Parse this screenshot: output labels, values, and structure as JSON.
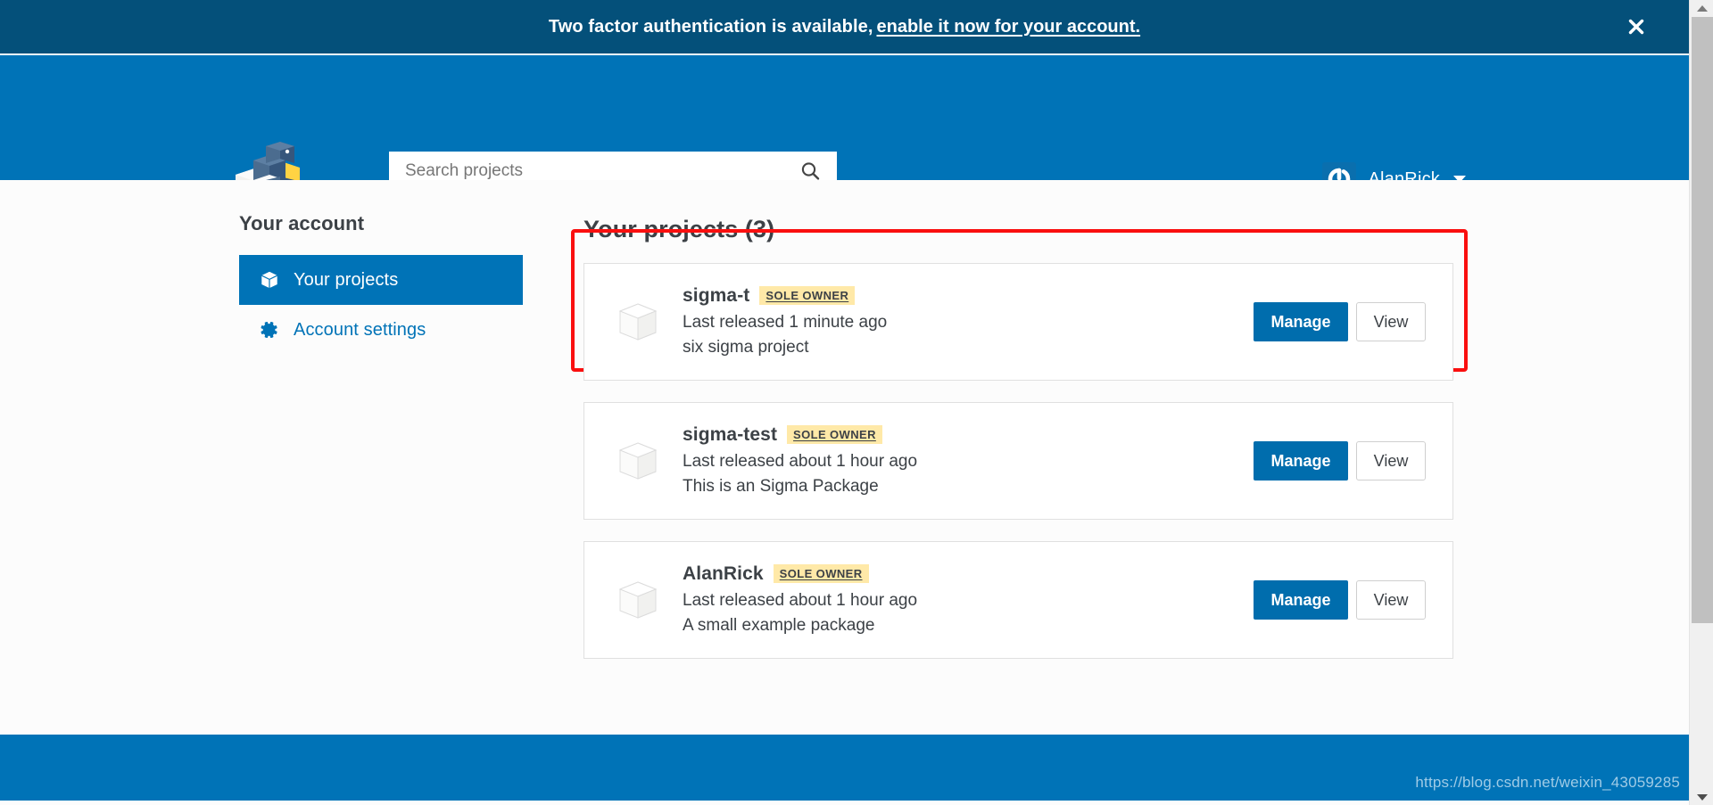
{
  "notification": {
    "text": "Two factor authentication is available,",
    "link_text": "enable it now for your account.",
    "close_icon": "close-icon"
  },
  "header": {
    "logo_icon": "pypi-cubes-logo",
    "search": {
      "placeholder": "Search projects",
      "value": "",
      "icon": "search-icon"
    },
    "user": {
      "name": "AlanRick",
      "avatar_icon": "gravatar-avatar",
      "caret_icon": "chevron-down-icon"
    }
  },
  "sidebar": {
    "title": "Your account",
    "items": [
      {
        "label": "Your projects",
        "icon": "cube-icon",
        "active": true
      },
      {
        "label": "Account settings",
        "icon": "gear-icon",
        "active": false
      }
    ]
  },
  "main": {
    "title": "Your projects (3)",
    "projects": [
      {
        "name": "sigma-t",
        "badge": "SOLE OWNER",
        "released": "Last released 1 minute ago",
        "description": "six sigma project",
        "manage_label": "Manage",
        "view_label": "View",
        "icon": "package-cube-icon",
        "highlighted": true
      },
      {
        "name": "sigma-test",
        "badge": "SOLE OWNER",
        "released": "Last released about 1 hour ago",
        "description": "This is an Sigma Package",
        "manage_label": "Manage",
        "view_label": "View",
        "icon": "package-cube-icon",
        "highlighted": false
      },
      {
        "name": "AlanRick",
        "badge": "SOLE OWNER",
        "released": "Last released about 1 hour ago",
        "description": "A small example package",
        "manage_label": "Manage",
        "view_label": "View",
        "icon": "package-cube-icon",
        "highlighted": false
      }
    ]
  },
  "footer": {
    "watermark": "https://blog.csdn.net/weixin_43059285"
  },
  "colors": {
    "banner_blue": "#04507a",
    "header_blue": "#0073b7",
    "button_blue": "#006dad",
    "badge_yellow": "#ffe9a8",
    "highlight_red": "#fa0f0f",
    "page_bg": "#fcfcfc",
    "text_dark": "#3c4146"
  }
}
